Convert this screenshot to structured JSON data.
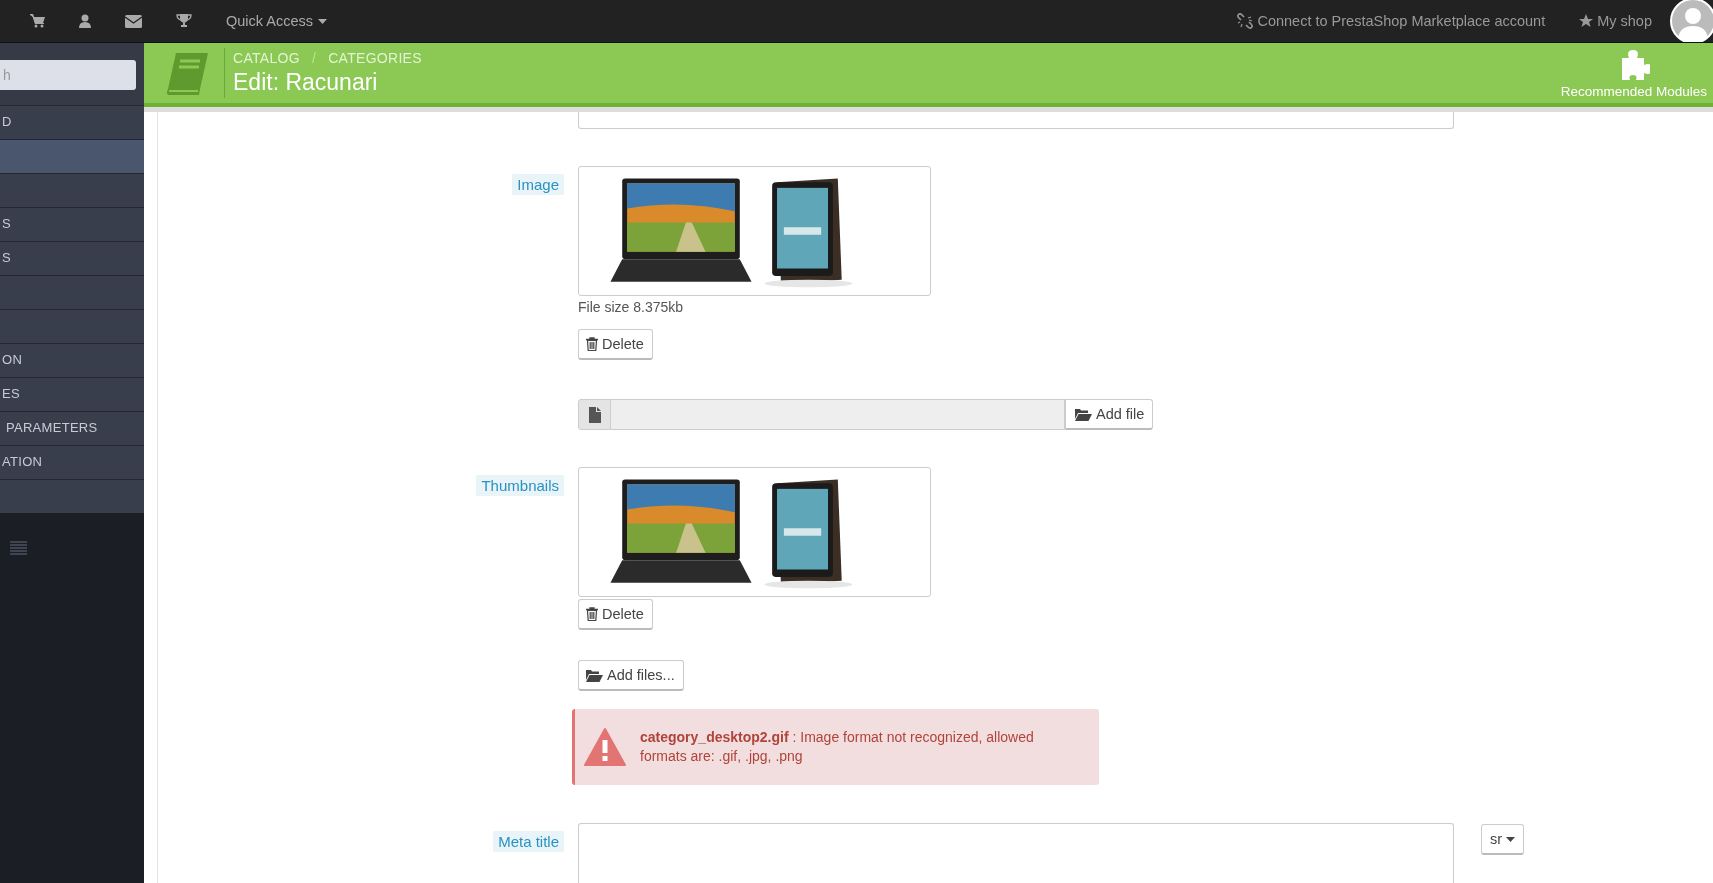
{
  "topbar": {
    "quick_access": "Quick Access",
    "connect": "Connect to PrestaShop Marketplace account",
    "my_shop": "My shop"
  },
  "sidebar": {
    "search_placeholder": "h",
    "items": [
      {
        "label": "D",
        "selected": false
      },
      {
        "selected": true
      },
      {
        "selected": false
      },
      {
        "label": "S",
        "selected": false
      },
      {
        "label": "S",
        "selected": false
      },
      {
        "selected": false
      },
      {
        "selected": false
      },
      {
        "label": "ON",
        "selected": false
      },
      {
        "label": "ES",
        "selected": false
      },
      {
        "label": " PARAMETERS",
        "selected": false
      },
      {
        "label": "ATION",
        "selected": false
      },
      {
        "selected": false
      }
    ]
  },
  "header": {
    "breadcrumb": [
      "CATALOG",
      "CATEGORIES"
    ],
    "breadcrumb_separator": "/",
    "title": "Edit: Racunari",
    "action": "Recommended Modules"
  },
  "form": {
    "image": {
      "label": "Image",
      "file_size": "File size 8.375kb",
      "delete": "Delete",
      "add": "Add file"
    },
    "thumbnails": {
      "label": "Thumbnails",
      "delete": "Delete",
      "add": "Add files..."
    },
    "alert": {
      "message": "**category_desktop2.gif** : Image format not recognized, allowed formats are: .gif, .jpg, .png"
    },
    "meta_title": {
      "label": "Meta title",
      "language": "sr"
    }
  }
}
